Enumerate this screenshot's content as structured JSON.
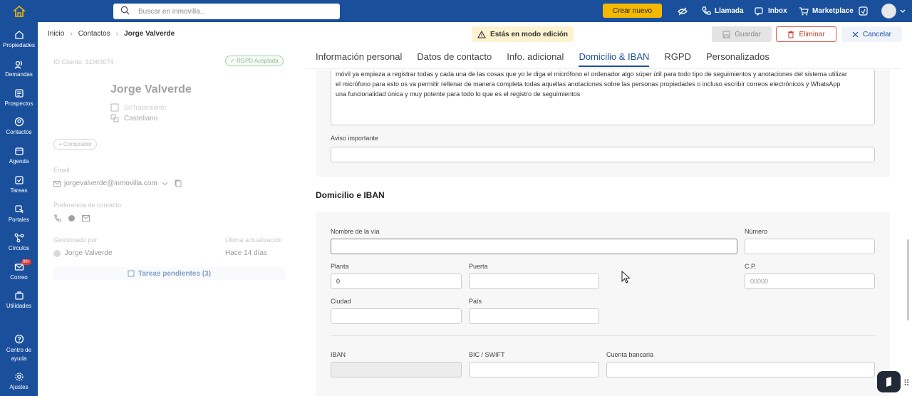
{
  "app": {
    "name": "inmovilla"
  },
  "topbar": {
    "search_placeholder": "Buscar en inmovilla...",
    "create_label": "Crear nuevo",
    "call_label": "Llamada",
    "inbox_label": "Inbox",
    "marketplace_label": "Marketplace"
  },
  "sidebar": {
    "items": [
      {
        "label": "Propiedades",
        "icon": "home-icon"
      },
      {
        "label": "Demandas",
        "icon": "signal-icon"
      },
      {
        "label": "Prospectos",
        "icon": "list-icon"
      },
      {
        "label": "Contactos",
        "icon": "contact-icon"
      },
      {
        "label": "Agenda",
        "icon": "calendar-icon"
      },
      {
        "label": "Tareas",
        "icon": "task-icon"
      },
      {
        "label": "Portales",
        "icon": "cursor-icon"
      },
      {
        "label": "Círculos",
        "icon": "circles-icon"
      },
      {
        "label": "Correo",
        "icon": "mail-icon",
        "badge": "99+"
      },
      {
        "label": "Utilidades",
        "icon": "briefcase-icon"
      },
      {
        "label": "Centro de ayuda",
        "icon": "help-icon"
      },
      {
        "label": "Ajustes",
        "icon": "gear-icon"
      }
    ]
  },
  "breadcrumb": {
    "items": [
      "Inicio",
      "Contactos",
      "Jorge Valverde"
    ]
  },
  "edit_mode_label": "Estás en modo edición",
  "actions": {
    "save": "Guardar",
    "delete": "Eliminar",
    "cancel": "Cancelar"
  },
  "contact": {
    "id_label": "ID Cliente: 31903074",
    "rgpd_badge": "RGPD Aceptada",
    "name": "Jorge Valverde",
    "greeting": "Sr/Tratamiento",
    "language": "Castellano",
    "tag": "+ Comprador",
    "email_label": "Email",
    "email": "jorgevalverde@inmovilla.com",
    "contact_pref_label": "Preferencia de contacto",
    "managed_by_label": "Gestionado por",
    "managed_by": "Jorge Valverde",
    "last_update_label": "Última actualización",
    "last_update": "Hace 14 días",
    "pending_tasks": "Tareas pendientes (3)"
  },
  "tabs": [
    {
      "label": "Información personal",
      "active": false
    },
    {
      "label": "Datos de contacto",
      "active": false
    },
    {
      "label": "Info. adicional",
      "active": false
    },
    {
      "label": "Domicilio & IBAN",
      "active": true
    },
    {
      "label": "RGPD",
      "active": false
    },
    {
      "label": "Personalizados",
      "active": false
    }
  ],
  "notes": {
    "text": [
      "móvil ya empieza a registrar todas y cada una de las cosas que yo le diga el micrófono el ordenador algo súper útil para todo tipo de seguimientos y anotaciones del sistema utilizar",
      "el micrófono para esto os va permitir rellenar de manera completa todas aquellas anotaciones sobre las personas propiedades o incluso escribir correos electrónicos y WhatsApp",
      "una funcionalidad única y muy potente para todo lo que es el registro de seguimientos"
    ],
    "important_label": "Aviso importante",
    "important_value": ""
  },
  "address": {
    "section_title": "Domicilio e IBAN",
    "street_label": "Nombre de la vía",
    "street_value": "",
    "number_label": "Número",
    "number_value": "",
    "floor_label": "Planta",
    "floor_value": "0",
    "door_label": "Puerta",
    "door_value": "",
    "zip_label": "C.P.",
    "zip_placeholder": "00000",
    "city_label": "Ciudad",
    "city_value": "",
    "country_label": "País",
    "country_value": "",
    "iban_label": "IBAN",
    "iban_value": "",
    "bic_label": "BIC / SWIFT",
    "bic_value": "",
    "account_label": "Cuenta bancaria",
    "account_value": ""
  },
  "colors": {
    "brand": "#1a4f9c",
    "accent": "#f5b800",
    "danger": "#e05a47"
  }
}
